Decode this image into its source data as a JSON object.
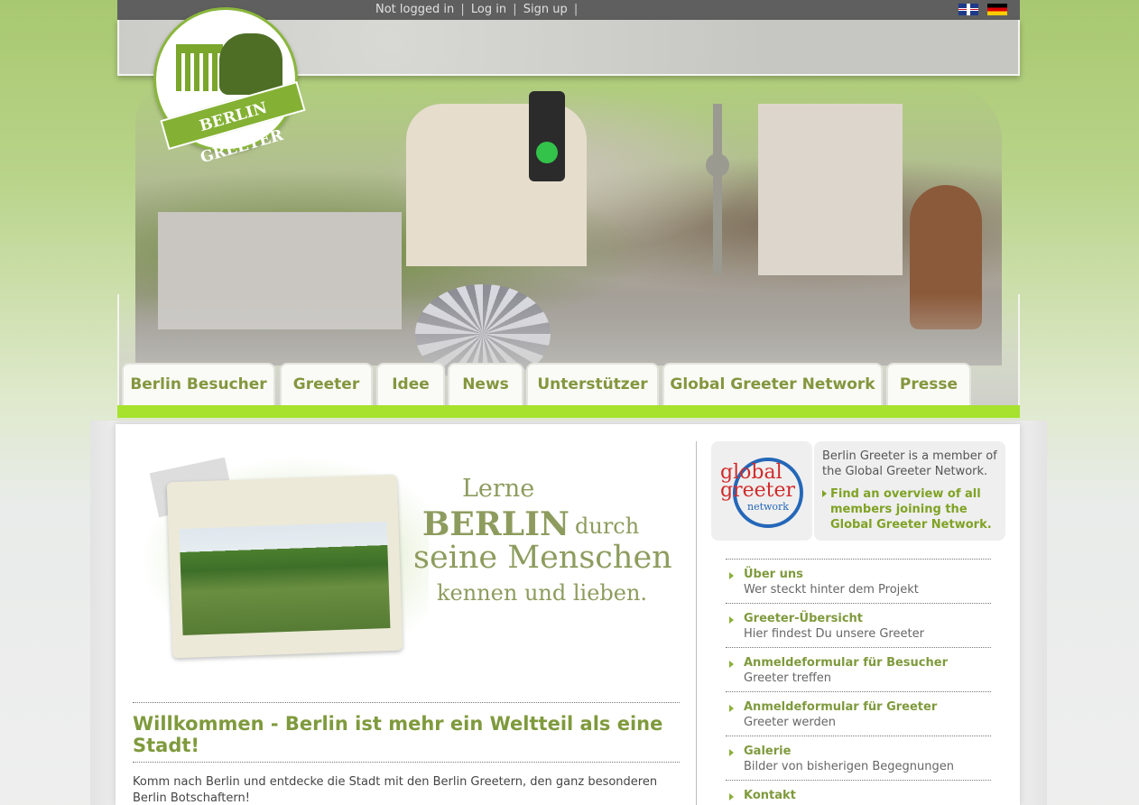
{
  "topbar": {
    "status": "Not logged in",
    "login": "Log in",
    "signup": "Sign up",
    "separator": "|",
    "languages": [
      "english-flag",
      "german-flag"
    ]
  },
  "logo": {
    "text": "BERLIN GREETER"
  },
  "nav": {
    "tabs": [
      {
        "label": "Berlin Besucher"
      },
      {
        "label": "Greeter"
      },
      {
        "label": "Idee"
      },
      {
        "label": "News"
      },
      {
        "label": "Unterstützer"
      },
      {
        "label": "Global Greeter Network"
      },
      {
        "label": "Presse"
      }
    ]
  },
  "slogan": {
    "line1": "Lerne",
    "line2a": "BERLIN",
    "line2b": "durch",
    "line3": "seine Menschen",
    "line4": "kennen und lieben."
  },
  "main": {
    "title": "Willkommen - Berlin ist mehr ein Weltteil als eine Stadt!",
    "intro": "Komm nach Berlin und entdecke die Stadt mit den Berlin Greetern, den ganz besonderen Berlin Botschaftern!"
  },
  "sidebar": {
    "gg_logo": {
      "line1": "global",
      "line2": "greeter",
      "line3": "network"
    },
    "member_text": "Berlin Greeter is a member of the Global Greeter Network.",
    "overview_link": "Find an overview of all members joining the Global Greeter Network.",
    "items": [
      {
        "title": "Über uns",
        "subtitle": "Wer steckt hinter dem Projekt"
      },
      {
        "title": "Greeter-Übersicht",
        "subtitle": "Hier findest Du unsere Greeter"
      },
      {
        "title": "Anmeldeformular für Besucher",
        "subtitle": "Greeter treffen"
      },
      {
        "title": "Anmeldeformular für Greeter",
        "subtitle": "Greeter werden"
      },
      {
        "title": "Galerie",
        "subtitle": "Bilder von bisherigen Begegnungen"
      },
      {
        "title": "Kontakt",
        "subtitle": ""
      }
    ]
  },
  "colors": {
    "accent_green": "#7f9a3d",
    "nav_bar": "#a6e22e",
    "topbar": "#5f5f5f"
  }
}
